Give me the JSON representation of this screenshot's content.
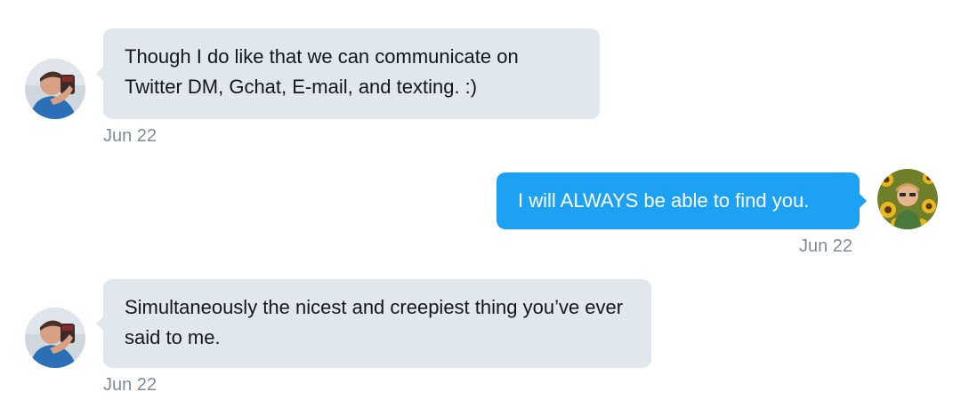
{
  "colors": {
    "incoming_bubble": "#e1e8ed",
    "outgoing_bubble": "#1da1f2",
    "timestamp": "#7f8c98"
  },
  "messages": [
    {
      "direction": "incoming",
      "text": "Though I do like that we can communicate on Twitter DM, Gchat, E-mail, and texting. :)",
      "timestamp": "Jun 22"
    },
    {
      "direction": "outgoing",
      "text": "I will ALWAYS be able to find you.",
      "timestamp": "Jun 22"
    },
    {
      "direction": "incoming",
      "text": "Simultaneously the nicest and creepiest thing you’ve ever said to me.",
      "timestamp": "Jun 22"
    }
  ]
}
